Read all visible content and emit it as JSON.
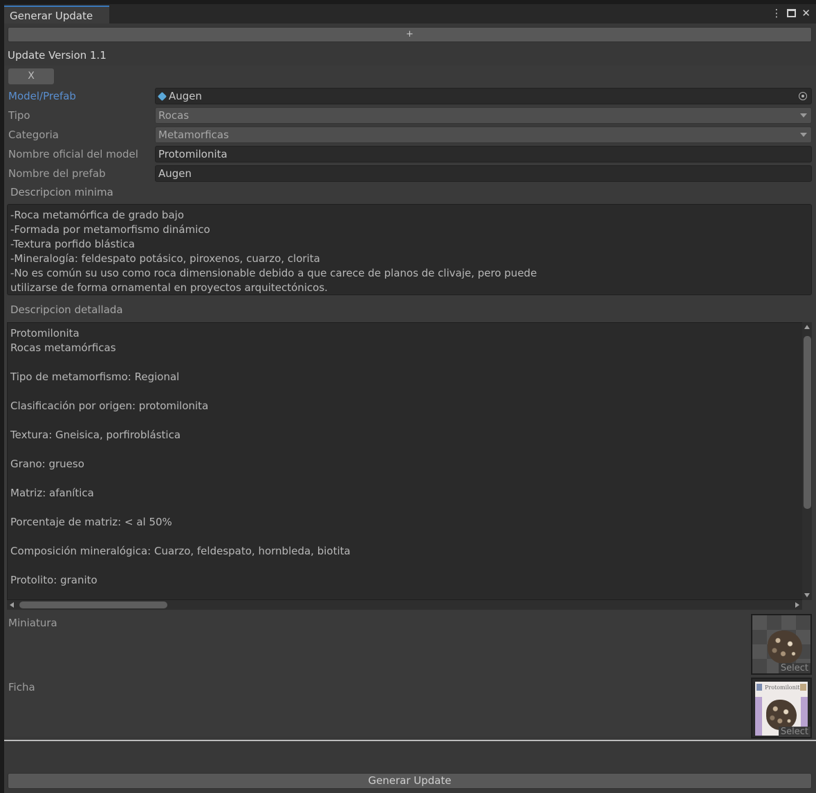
{
  "window": {
    "tab_title": "Generar Update",
    "controls": [
      "⋮",
      "maximize",
      "✕"
    ]
  },
  "add_button_label": "+",
  "update": {
    "title": "Update Version 1.1",
    "remove_label": "X",
    "fields": {
      "model_prefab": {
        "label": "Model/Prefab",
        "value": "Augen",
        "icon": "cube-icon"
      },
      "tipo": {
        "label": "Tipo",
        "value": "Rocas"
      },
      "categoria": {
        "label": "Categoria",
        "value": "Metamorficas"
      },
      "nombre_oficial": {
        "label": "Nombre oficial del model",
        "value": "Protomilonita"
      },
      "nombre_prefab": {
        "label": "Nombre del prefab",
        "value": "Augen"
      }
    },
    "descripcion_minima": {
      "label": "Descripcion minima",
      "lines": [
        "-Roca metamórfica de grado bajo",
        "-Formada por metamorfismo dinámico",
        "-Textura porfido blástica",
        "-Mineralogía: feldespato potásico, piroxenos, cuarzo, clorita",
        "-No es común su uso como roca dimensionable debido a que carece de planos de clivaje, pero puede",
        "utilizarse de forma ornamental en proyectos arquitectónicos."
      ]
    },
    "descripcion_detallada": {
      "label": "Descripcion detallada",
      "lines": [
        "Protomilonita",
        "Rocas metamórficas",
        "",
        "Tipo de metamorfismo: Regional",
        "",
        "Clasificación por origen: protomilonita",
        "",
        "Textura: Gneisica, porfiroblástica",
        "",
        "Grano: grueso",
        "",
        "Matriz: afanítica",
        "",
        "Porcentaje de matriz: < al 50%",
        "",
        "Composición mineralógica: Cuarzo, feldespato, hornbleda, biotita",
        "",
        "Protolito: granito"
      ]
    },
    "miniatura": {
      "label": "Miniatura",
      "select_label": "Select"
    },
    "ficha": {
      "label": "Ficha",
      "select_label": "Select",
      "thumb_title": "Protomilonita"
    }
  },
  "generate_button_label": "Generar Update",
  "colors": {
    "accent_blue": "#5a8fd0",
    "tab_highlight": "#3a79bb",
    "panel_bg": "#383838"
  }
}
